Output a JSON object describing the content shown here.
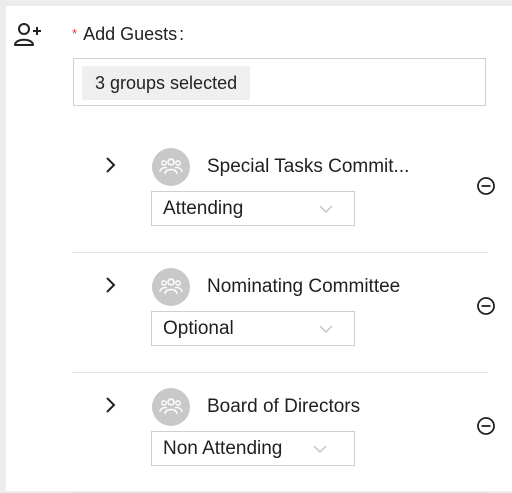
{
  "form": {
    "add_guests_label": "Add Guests",
    "required_marker": "*",
    "colon": ":",
    "selection_summary": "3 groups selected"
  },
  "groups": [
    {
      "name": "Special Tasks Commit...",
      "status": "Attending"
    },
    {
      "name": "Nominating Committee",
      "status": "Optional"
    },
    {
      "name": "Board of Directors",
      "status": "Non Attending"
    }
  ],
  "icons": {
    "add_guest": "add-user-icon",
    "expand": "chevron-right-icon",
    "group_avatar": "group-icon",
    "dropdown": "chevron-down-icon",
    "remove": "minus-circle-icon"
  },
  "colors": {
    "required": "#e0393e",
    "avatar_bg": "#c8c8c8",
    "border": "#cfcfcf"
  }
}
